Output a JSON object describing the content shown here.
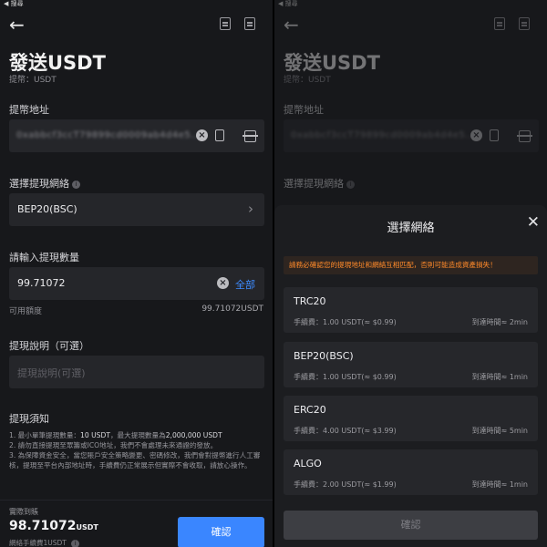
{
  "status_bar": {
    "back_label": "◀ 搜尋"
  },
  "page": {
    "title": "發送USDT",
    "subtitle": "提幣：USDT"
  },
  "address_field": {
    "label": "提幣地址",
    "value": "0xabbcf3ccT79899cd0009ab4d4e5..."
  },
  "network_field": {
    "label": "選擇提現網絡",
    "value": "BEP20(BSC)"
  },
  "amount_field": {
    "label": "請輸入提現數量",
    "value": "99.71072",
    "all_label": "全部",
    "available_label": "可用額度",
    "available_value": "99.71072USDT"
  },
  "memo_field": {
    "label": "提現說明（可選）",
    "placeholder": "提現說明(可選)"
  },
  "notes": {
    "title": "提現須知",
    "line1_prefix": "1. 最小單筆提現數量：",
    "line1_min": "10 USDT",
    "line1_mid": "，最大提現數量為",
    "line1_max": "2,000,000 USDT",
    "line2": "2. 請勿直接提現至眾籌或ICO地址，我們不會處理未來通證的發放。",
    "line3": "3. 為保障資金安全，當您賬戶安全策略變更、密碼修改，我們會對提幣進行人工審核，提現至平台內部地址時，手續費仍正常展示但實際不會收取，請放心操作。"
  },
  "bottom": {
    "receive_label": "實際到賬",
    "receive_amount": "98.71072",
    "receive_unit": "USDT",
    "fee_note": "網絡手續費1USDT",
    "confirm_label": "確認"
  },
  "sheet": {
    "title": "選擇網絡",
    "warning": "請務必確認您的提現地址和網絡互相匹配，否則可能造成資產損失！",
    "networks": [
      {
        "name": "TRC20",
        "fee": "手續費：1.00 USDT(≈ $0.99)",
        "time": "到達時間≈ 2min"
      },
      {
        "name": "BEP20(BSC)",
        "fee": "手續費：1.00 USDT(≈ $0.99)",
        "time": "到達時間≈ 1min"
      },
      {
        "name": "ERC20",
        "fee": "手續費：4.00 USDT(≈ $3.99)",
        "time": "到達時間≈ 5min"
      },
      {
        "name": "ALGO",
        "fee": "手續費：2.00 USDT(≈ $1.99)",
        "time": "到達時間≈ 1min"
      }
    ],
    "confirm_label": "確認"
  },
  "colors": {
    "accent": "#3a86ff",
    "warning": "#ff8a2a",
    "background": "#17181b"
  }
}
